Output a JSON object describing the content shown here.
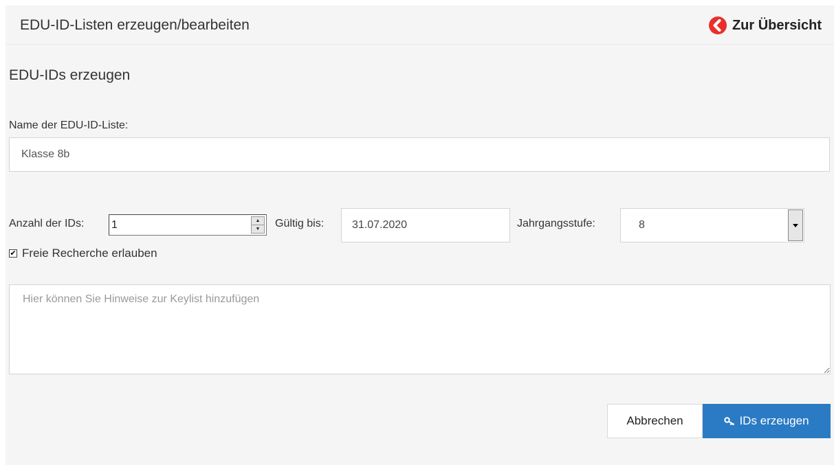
{
  "header": {
    "title": "EDU-ID-Listen erzeugen/bearbeiten",
    "overview_link": "Zur Übersicht",
    "overview_icon": "arrow-left-circle-icon",
    "accent_color": "#e8302a"
  },
  "form": {
    "section_title": "EDU-IDs erzeugen",
    "name_label": "Name der EDU-ID-Liste:",
    "name_value": "Klasse 8b",
    "count_label": "Anzahl der IDs:",
    "count_value": "1",
    "valid_until_label": "Gültig bis:",
    "valid_until_value": "31.07.2020",
    "grade_label": "Jahrgangsstufe:",
    "grade_value": "8",
    "free_research_label": "Freie Recherche erlauben",
    "free_research_checked": true,
    "notes_placeholder": "Hier können Sie Hinweise zur Keylist hinzufügen",
    "notes_value": ""
  },
  "buttons": {
    "cancel_label": "Abbrechen",
    "generate_label": "IDs erzeugen",
    "generate_icon": "key-icon",
    "primary_color": "#2a7bc4"
  }
}
